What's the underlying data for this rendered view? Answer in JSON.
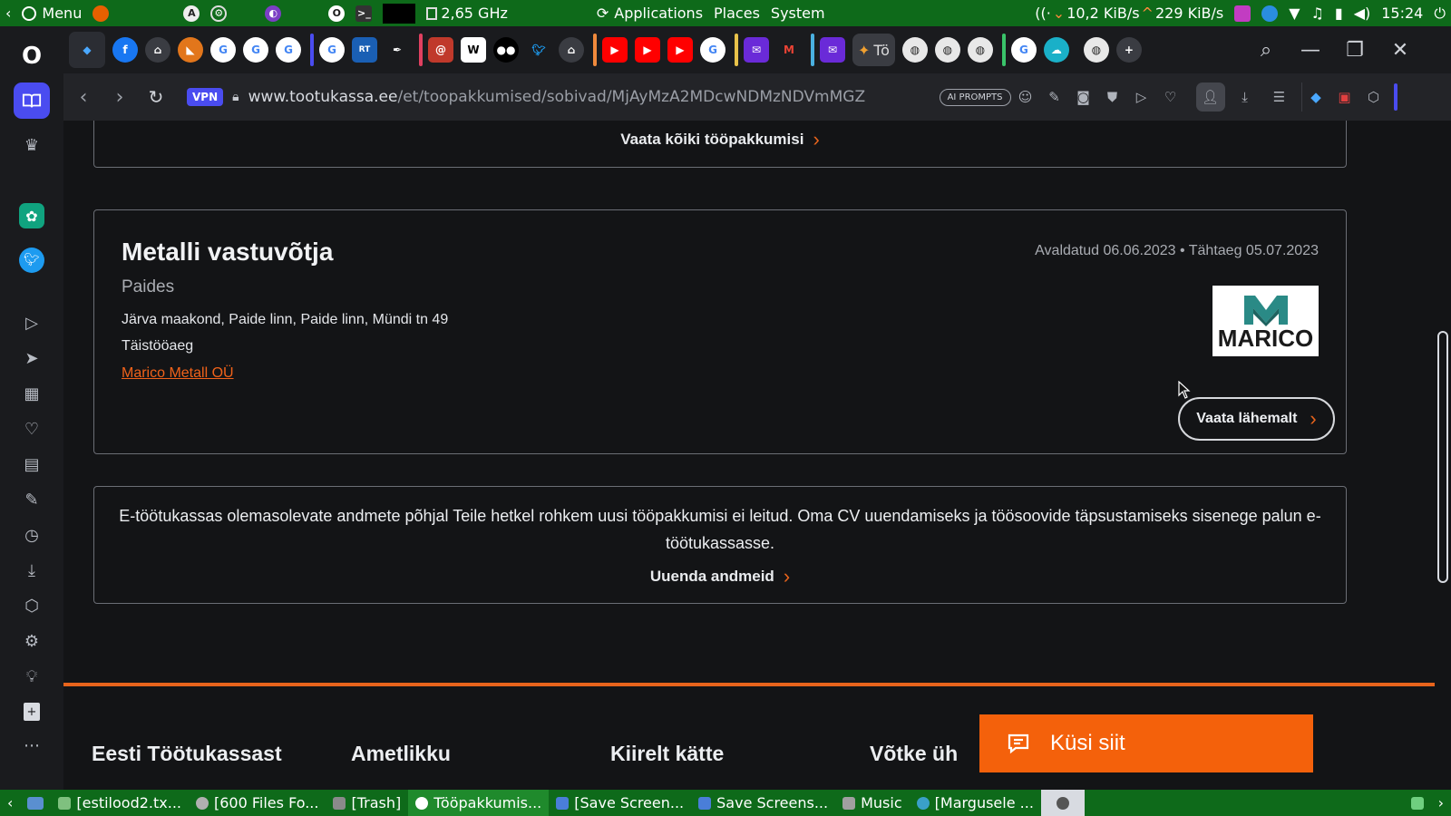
{
  "os_panel": {
    "menu_label": "Menu",
    "cpu_freq": "2,65 GHz",
    "applications": "Applications",
    "places": "Places",
    "system": "System",
    "net_down": "10,2 KiB/s",
    "net_up": "229 KiB/s",
    "clock": "15:24"
  },
  "browser": {
    "vpn_label": "VPN",
    "url_host": "www.tootukassa.ee",
    "url_path": "/et/toopakkumised/sobivad/MjAyMzA2MDcwNDMzNDVmMGZ",
    "ai_prompts": "AI PROMPTS",
    "active_tab_label": "Tö"
  },
  "page": {
    "view_all_link": "Vaata kõiki tööpakkumisi",
    "job": {
      "title": "Metalli vastuvõtja",
      "city": "Paides",
      "address": "Järva maakond, Paide linn, Paide linn, Mündi tn 49",
      "work_time": "Täistööaeg",
      "company": "Marico Metall OÜ",
      "dates": "Avaldatud 06.06.2023 • Tähtaeg 05.07.2023",
      "logo_text": "MARICO",
      "more_button": "Vaata lähemalt"
    },
    "info": {
      "text": "E-töötukassas olemasolevate andmete põhjal Teile hetkel rohkem uusi tööpakkumisi ei leitud. Oma CV uuendamiseks ja töösoovide täpsustamiseks sisenege palun e-töötukassasse.",
      "update_link": "Uuenda andmeid"
    },
    "footer_headings": [
      "Eesti Töötukassast",
      "Ametlikku",
      "Kiirelt kätte",
      "Võtke üh"
    ],
    "chat_button": "Küsi siit"
  },
  "taskbar": {
    "items": [
      "[estilood2.tx...",
      "[600 Files Fo...",
      "[Trash]",
      "Tööpakkumis...",
      "[Save Screen...",
      "Save Screens...",
      "Music",
      "[Margusele ..."
    ]
  },
  "colors": {
    "os_green": "#0e6a1a",
    "accent_orange": "#e8641c",
    "chat_orange": "#f4610b",
    "opera_blue": "#4a4cf0"
  }
}
